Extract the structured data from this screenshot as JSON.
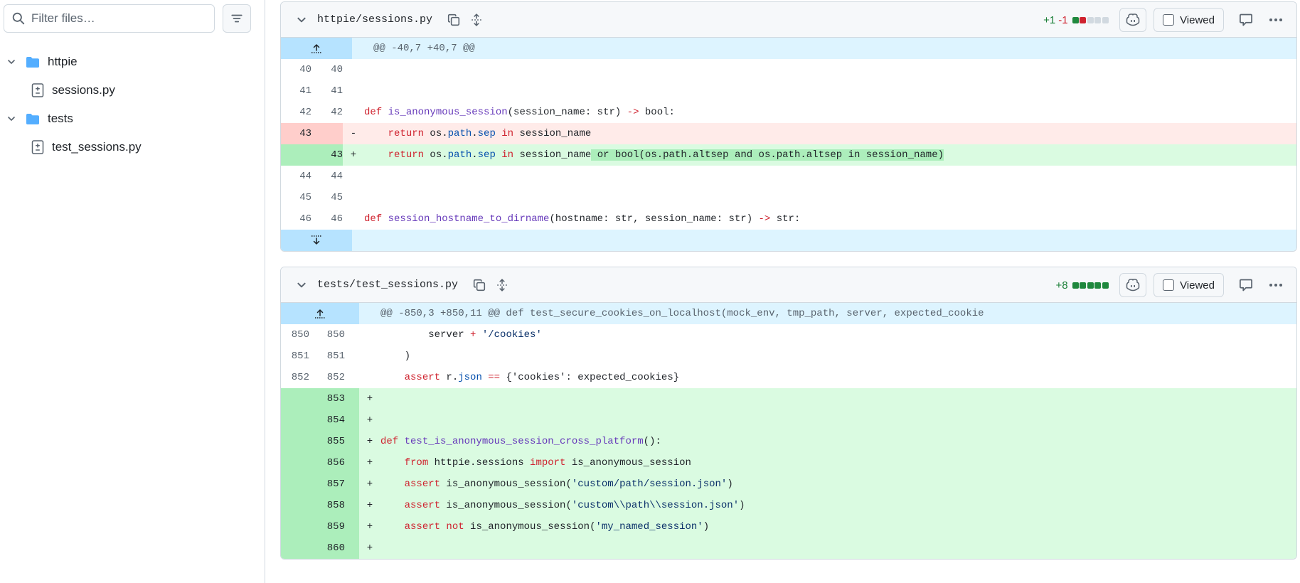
{
  "sidebar": {
    "filter_placeholder": "Filter files…",
    "tree": [
      {
        "label": "httpie",
        "kind": "folder"
      },
      {
        "label": "sessions.py",
        "kind": "file"
      },
      {
        "label": "tests",
        "kind": "folder"
      },
      {
        "label": "test_sessions.py",
        "kind": "file"
      }
    ]
  },
  "files": [
    {
      "path": "httpie/sessions.py",
      "additions": "+1",
      "deletions": "-1",
      "viewed_label": "Viewed",
      "hunk_header": "@@ -40,7 +40,7 @@",
      "lines": [
        {
          "old": "40",
          "new": "40",
          "sign": "",
          "type": "ctx"
        },
        {
          "old": "41",
          "new": "41",
          "sign": "",
          "type": "ctx"
        },
        {
          "old": "42",
          "new": "42",
          "sign": "",
          "type": "ctx"
        },
        {
          "old": "43",
          "new": "",
          "sign": "-",
          "type": "del"
        },
        {
          "old": "",
          "new": "43",
          "sign": "+",
          "type": "add"
        },
        {
          "old": "44",
          "new": "44",
          "sign": "",
          "type": "ctx"
        },
        {
          "old": "45",
          "new": "45",
          "sign": "",
          "type": "ctx"
        },
        {
          "old": "46",
          "new": "46",
          "sign": "",
          "type": "ctx"
        }
      ],
      "code": {
        "l42_def": "def ",
        "l42_fn": "is_anonymous_session",
        "l42_rest": "(session_name: str) ",
        "l42_arrow": "->",
        "l42_tail": " bool:",
        "l43_indent": "    ",
        "l43_return": "return",
        "l43_os": " os.",
        "l43_path": "path",
        "l43_dot": ".",
        "l43_sep": "sep",
        "l43_in": " in",
        "l43_name": " session_name",
        "l43_added": " or bool(os.path.altsep and os.path.altsep in session_name)",
        "l46_def": "def ",
        "l46_fn": "session_hostname_to_dirname",
        "l46_rest": "(hostname: str, session_name: str) ",
        "l46_arrow": "->",
        "l46_tail": " str:"
      }
    },
    {
      "path": "tests/test_sessions.py",
      "additions": "+8",
      "viewed_label": "Viewed",
      "hunk_header": "@@ -850,3 +850,11 @@ def test_secure_cookies_on_localhost(mock_env, tmp_path, server, expected_cookie",
      "lines": [
        {
          "old": "850",
          "new": "850",
          "sign": "",
          "type": "ctx"
        },
        {
          "old": "851",
          "new": "851",
          "sign": "",
          "type": "ctx"
        },
        {
          "old": "852",
          "new": "852",
          "sign": "",
          "type": "ctx"
        },
        {
          "old": "",
          "new": "853",
          "sign": "+",
          "type": "add"
        },
        {
          "old": "",
          "new": "854",
          "sign": "+",
          "type": "add"
        },
        {
          "old": "",
          "new": "855",
          "sign": "+",
          "type": "add"
        },
        {
          "old": "",
          "new": "856",
          "sign": "+",
          "type": "add"
        },
        {
          "old": "",
          "new": "857",
          "sign": "+",
          "type": "add"
        },
        {
          "old": "",
          "new": "858",
          "sign": "+",
          "type": "add"
        },
        {
          "old": "",
          "new": "859",
          "sign": "+",
          "type": "add"
        },
        {
          "old": "",
          "new": "860",
          "sign": "+",
          "type": "add"
        }
      ],
      "code": {
        "l850_indent": "        ",
        "l850_server": "server ",
        "l850_plus": "+",
        "l850_str": " '/cookies'",
        "l851": "    )",
        "l852_indent": "    ",
        "l852_assert": "assert",
        "l852_r": " r.",
        "l852_json": "json",
        "l852_eq": " ==",
        "l852_rest": " {'cookies': expected_cookies}",
        "l855_def": "def ",
        "l855_fn": "test_is_anonymous_session_cross_platform",
        "l855_rest": "():",
        "l856_indent": "    ",
        "l856_from": "from",
        "l856_mod": " httpie.sessions ",
        "l856_import": "import",
        "l856_name": " is_anonymous_session",
        "l857_indent": "    ",
        "l857_assert": "assert",
        "l857_call": " is_anonymous_session(",
        "l857_str": "'custom/path/session.json'",
        "l857_close": ")",
        "l858_indent": "    ",
        "l858_assert": "assert",
        "l858_call": " is_anonymous_session(",
        "l858_str": "'custom\\\\path\\\\session.json'",
        "l858_close": ")",
        "l859_indent": "    ",
        "l859_assert": "assert",
        "l859_not": " not",
        "l859_call": " is_anonymous_session(",
        "l859_str": "'my_named_session'",
        "l859_close": ")"
      }
    }
  ],
  "colors": {
    "addition": "#1a7f37",
    "deletion": "#cf222e",
    "hunk_bg": "#ddf4ff",
    "add_bg": "#dafbe1",
    "del_bg": "#ffebe9"
  }
}
